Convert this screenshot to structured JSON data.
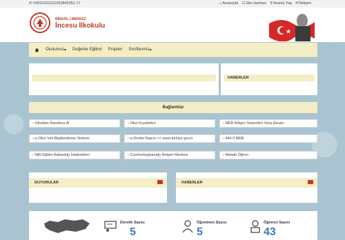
{
  "topbar": {
    "phone": "04262261101053842051 17",
    "links": [
      {
        "icon": "home-icon",
        "label": "Anasayfa"
      },
      {
        "icon": "sitemap-icon",
        "label": "Site Haritası"
      },
      {
        "icon": "search-icon",
        "label": "Arama Yap"
      },
      {
        "icon": "mail-icon",
        "label": "İletişim"
      }
    ]
  },
  "header": {
    "tag": "BİNGÖL | MERKEZ",
    "school_name": "İncesu İlkokulu"
  },
  "nav": {
    "items": [
      "Okulumuz",
      "Değerler Eğitimi",
      "Projeler",
      "Sınıflarımız"
    ]
  },
  "panels": {
    "news_top": "HABERLER",
    "links_title": "Bağlantılar",
    "announcements": "DUYURULAR",
    "news_bottom": "HABERLER"
  },
  "links": [
    "Okuldan Randevu Al",
    "Okul Kıyafetleri",
    "MEB Bilişim Sistemleri Giriş Ekranı",
    "e-Okul Veli Bilgilendirme Sistemi",
    "e-Devlet Kapısı >> www.turkiye.gov.tr",
    "444 0 MEB",
    "Milli Eğitim Bakanlığı İstatistikleri",
    "Cumhurbaşkanlığı İletişim Merkezi",
    "Mebde Öğren"
  ],
  "stats": [
    {
      "label": "Derslik Sayısı",
      "value": "5"
    },
    {
      "label": "Öğretmen Sayısı",
      "value": "5"
    },
    {
      "label": "Öğrenci Sayısı",
      "value": "43"
    }
  ],
  "colors": {
    "accent": "#c0392b",
    "panel_head": "#f5edc6",
    "stat_number": "#3a7ab7"
  }
}
